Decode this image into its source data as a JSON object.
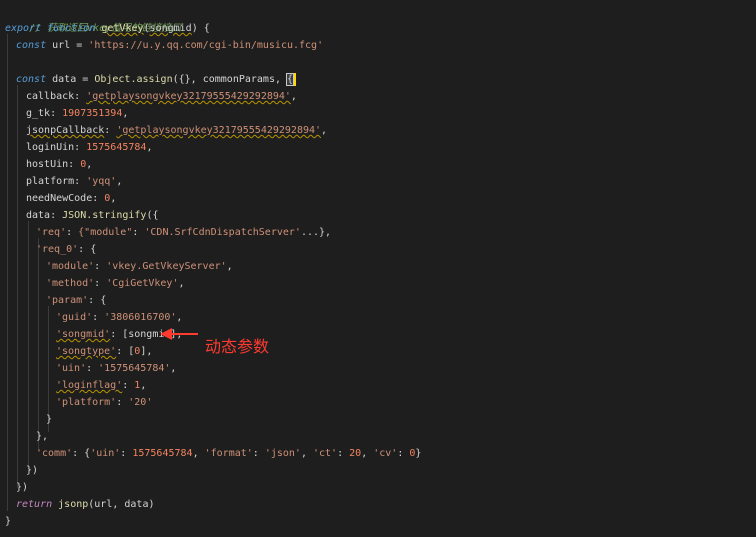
{
  "code": {
    "comment": "// 获取返回vkey值用的链接接口",
    "l2_export": "export",
    "l2_function": "function",
    "l2_name": "getVkey",
    "l2_param": "songmid",
    "l3_const": "const",
    "l3_url_var": "url",
    "l3_url_str": "'https://u.y.qq.com/cgi-bin/musicu.fcg'",
    "l5_const": "const",
    "l5_data_var": "data",
    "l5_assign": "Object.assign",
    "l5_common": "commonParams",
    "callback_key": "callback",
    "callback_val": "'getplaysongvkey3217955542929289​4'",
    "gtk_key": "g_tk",
    "gtk_val": "1907351394",
    "jsonp_key": "jsonpCallback",
    "jsonp_val": "'getplaysongvkey32179555429292894'",
    "loginuin_key": "loginUin",
    "loginuin_val": "1575645784",
    "hostuin_key": "hostUin",
    "hostuin_val": "0",
    "platform_key": "platform",
    "platform_val": "'yqq'",
    "neednew_key": "needNewCode",
    "neednew_val": "0",
    "data_key": "data",
    "json_stringify": "JSON.stringify",
    "req_key": "'req'",
    "req_val_a": "{\"module\"",
    "req_val_b": "'CDN.SrfCdnDispatchServer'",
    "req_val_c": "...},",
    "req0_key": "'req_0'",
    "module_key": "'module'",
    "module_val": "'vkey.GetVkeyServer'",
    "method_key": "'method'",
    "method_val": "'CgiGetVkey'",
    "param_key": "'param'",
    "guid_key": "'guid'",
    "guid_val": "'3806016700'",
    "songmid_key": "'songmid'",
    "songmid_val": "songmid",
    "songtype_key": "'songtype'",
    "songtype_val": "0",
    "uin_key": "'uin'",
    "uin_val": "'1575645784'",
    "loginflag_key": "'loginflag'",
    "loginflag_val": "1",
    "platform2_key": "'platform'",
    "platform2_val": "'20'",
    "comm_key": "'comm'",
    "comm_uin_key": "'uin'",
    "comm_uin_val": "1575645784",
    "comm_format_key": "'format'",
    "comm_format_val": "'json'",
    "comm_ct_key": "'ct'",
    "comm_ct_val": "20",
    "comm_cv_key": "'cv'",
    "comm_cv_val": "0",
    "return_kw": "return",
    "return_call": "jsonp",
    "return_args": "(url, data)"
  },
  "annotation": {
    "label": "动态参数",
    "color": "#ff3b30"
  },
  "theme": {
    "background": "#1e1e1e",
    "keyword": "#569cd6",
    "string": "#ce9178",
    "number": "#f4845f",
    "comment": "#6a9955"
  }
}
